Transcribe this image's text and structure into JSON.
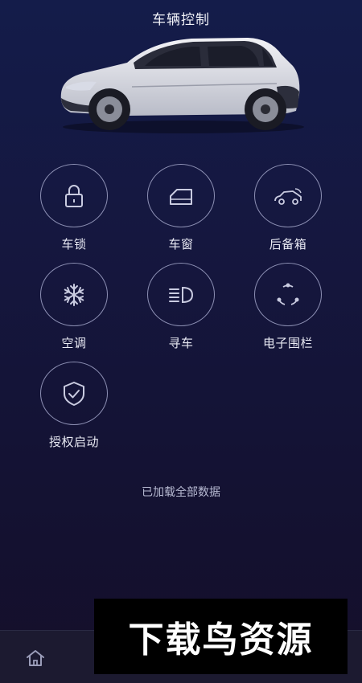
{
  "header": {
    "title": "车辆控制"
  },
  "controls": [
    {
      "label": "车锁",
      "icon": "lock-icon"
    },
    {
      "label": "车窗",
      "icon": "window-icon"
    },
    {
      "label": "后备箱",
      "icon": "trunk-icon"
    },
    {
      "label": "空调",
      "icon": "snowflake-icon"
    },
    {
      "label": "寻车",
      "icon": "headlight-icon"
    },
    {
      "label": "电子围栏",
      "icon": "geofence-icon"
    },
    {
      "label": "授权启动",
      "icon": "shield-check-icon"
    }
  ],
  "status": {
    "text": "已加载全部数据"
  },
  "bottom_nav": {
    "home_icon": "home-icon"
  },
  "watermark": {
    "text": "下载鸟资源"
  },
  "colors": {
    "ring": "#8d90b4",
    "background_top": "#141c4a",
    "background_bottom": "#150f2a"
  }
}
